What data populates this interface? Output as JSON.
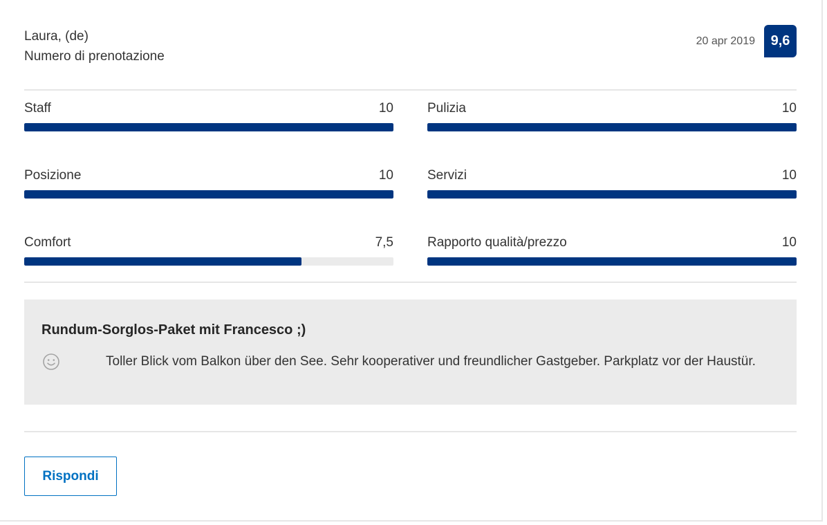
{
  "reviewer": {
    "name": "Laura, (de)",
    "subtitle": "Numero di prenotazione"
  },
  "review_date": "20 apr 2019",
  "overall_score": "9,6",
  "categories": [
    {
      "label": "Staff",
      "value": "10",
      "score": 10
    },
    {
      "label": "Pulizia",
      "value": "10",
      "score": 10
    },
    {
      "label": "Posizione",
      "value": "10",
      "score": 10
    },
    {
      "label": "Servizi",
      "value": "10",
      "score": 10
    },
    {
      "label": "Comfort",
      "value": "7,5",
      "score": 7.5
    },
    {
      "label": "Rapporto qualità/prezzo",
      "value": "10",
      "score": 10
    }
  ],
  "score_max": 10,
  "review": {
    "title": "Rundum-Sorglos-Paket mit Francesco ;)",
    "positive_icon": "smile-icon",
    "positive_text": "Toller Blick vom Balkon über den See. Sehr kooperativer und freundlicher Gastgeber. Parkplatz vor der Haustür."
  },
  "reply_button_label": "Rispondi",
  "colors": {
    "brand_dark_blue": "#003580",
    "link_blue": "#0071c2",
    "bar_track": "#ebebeb",
    "review_background": "#ebebeb"
  }
}
